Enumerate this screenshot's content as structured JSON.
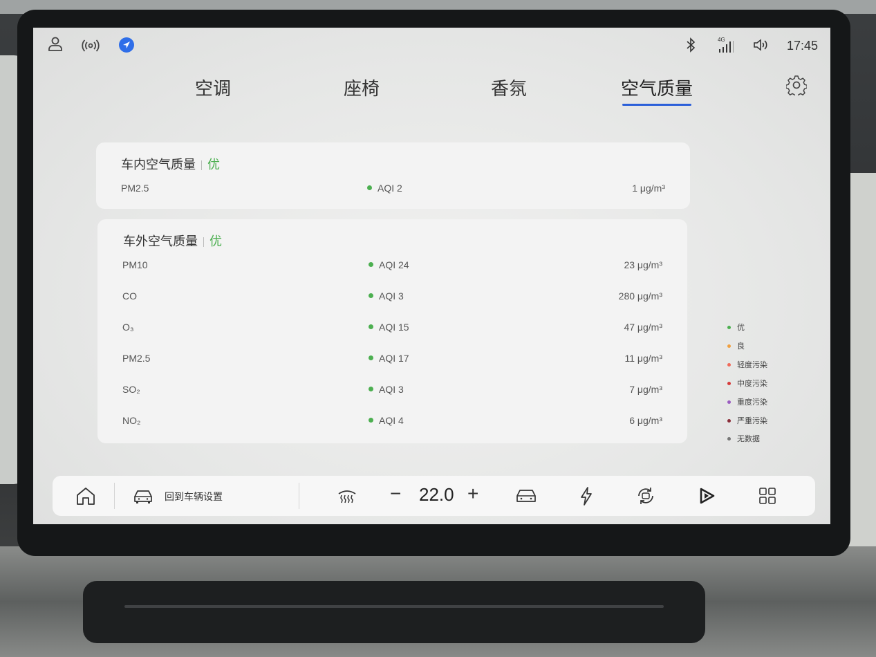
{
  "status_bar": {
    "time": "17:45",
    "signal_label": "4G"
  },
  "tabs": [
    {
      "label": "空调",
      "active": false
    },
    {
      "label": "座椅",
      "active": false
    },
    {
      "label": "香氛",
      "active": false
    },
    {
      "label": "空气质量",
      "active": true
    }
  ],
  "inside": {
    "title": "车内空气质量",
    "grade": "优",
    "rows": [
      {
        "name": "PM2.5",
        "aqi": "AQI  2",
        "value": "1 μg/m³"
      }
    ]
  },
  "outside": {
    "title": "车外空气质量",
    "grade": "优",
    "rows": [
      {
        "name": "PM10",
        "aqi": "AQI  24",
        "value": "23 μg/m³"
      },
      {
        "name": "CO",
        "aqi": "AQI  3",
        "value": "280 μg/m³"
      },
      {
        "name": "O₃",
        "aqi": "AQI  15",
        "value": "47 μg/m³"
      },
      {
        "name": "PM2.5",
        "aqi": "AQI  17",
        "value": "11 μg/m³"
      },
      {
        "name": "SO₂",
        "aqi": "AQI  3",
        "value": "7 μg/m³"
      },
      {
        "name": "NO₂",
        "aqi": "AQI  4",
        "value": "6 μg/m³"
      }
    ]
  },
  "legend": [
    {
      "label": "优",
      "color": "#4caf50"
    },
    {
      "label": "良",
      "color": "#f0a040"
    },
    {
      "label": "轻度污染",
      "color": "#f06a5a"
    },
    {
      "label": "中度污染",
      "color": "#d63a3a"
    },
    {
      "label": "重度污染",
      "color": "#9a5cc0"
    },
    {
      "label": "严重污染",
      "color": "#8b2e3a"
    },
    {
      "label": "无数据",
      "color": "#777777"
    }
  ],
  "colors": {
    "accent": "#2b5fd9",
    "good": "#4caf50"
  },
  "dock": {
    "back_label": "回到车辆设置",
    "temperature": "22.0",
    "minus": "−",
    "plus": "+",
    "icons": [
      "home-icon",
      "car-icon",
      "defrost-icon",
      "car-front-icon",
      "charge-icon",
      "recirculation-icon",
      "media-play-icon",
      "apps-grid-icon"
    ]
  }
}
